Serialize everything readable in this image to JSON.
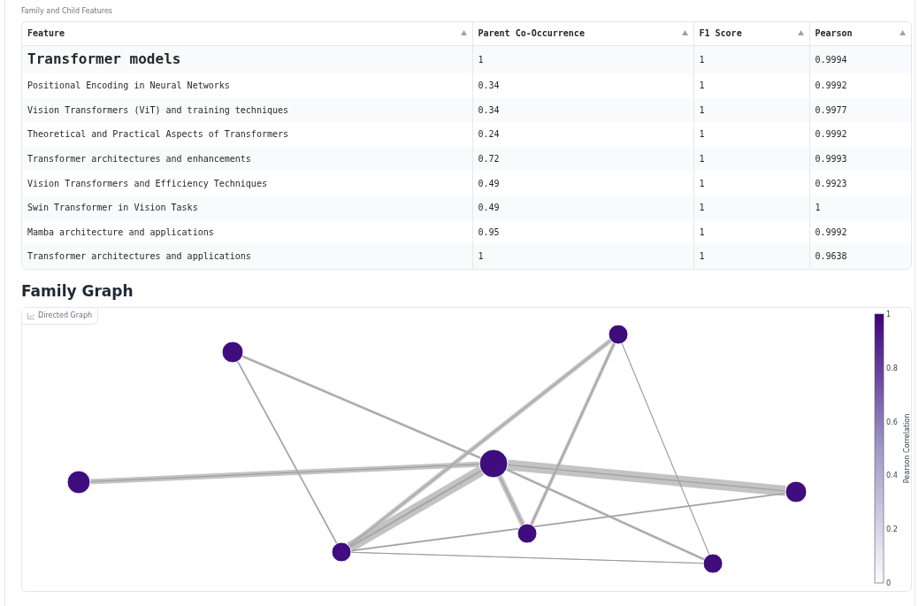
{
  "table_title": "Family and Child Features",
  "table": {
    "columns": [
      "Feature",
      "Parent Co-Occurrence",
      "F1 Score",
      "Pearson"
    ],
    "rows": [
      {
        "kind": "parent",
        "cells": [
          "Transformer models",
          "1",
          "1",
          "0.9994"
        ]
      },
      {
        "kind": "child",
        "cells": [
          "Positional Encoding in Neural Networks",
          "0.34",
          "1",
          "0.9992"
        ]
      },
      {
        "kind": "child",
        "cells": [
          "Vision Transformers (ViT) and training techniques",
          "0.34",
          "1",
          "0.9977"
        ]
      },
      {
        "kind": "child",
        "cells": [
          "Theoretical and Practical Aspects of Transformers",
          "0.24",
          "1",
          "0.9992"
        ]
      },
      {
        "kind": "child",
        "cells": [
          "Transformer architectures and enhancements",
          "0.72",
          "1",
          "0.9993"
        ]
      },
      {
        "kind": "child",
        "cells": [
          "Vision Transformers and Efficiency Techniques",
          "0.49",
          "1",
          "0.9923"
        ]
      },
      {
        "kind": "child",
        "cells": [
          "Swin Transformer in Vision Tasks",
          "0.49",
          "1",
          "1"
        ]
      },
      {
        "kind": "child",
        "cells": [
          "Mamba architecture and applications",
          "0.95",
          "1",
          "0.9992"
        ]
      },
      {
        "kind": "child",
        "cells": [
          "Transformer architectures and applications",
          "1",
          "1",
          "0.9638"
        ]
      }
    ]
  },
  "graph_heading": "Family Graph",
  "graph": {
    "tab": "Directed Graph",
    "colorbar": {
      "title": "Pearson Correlation",
      "ticks": [
        "1",
        "0.8",
        "0.6",
        "0.4",
        "0.2",
        "0"
      ]
    }
  }
}
